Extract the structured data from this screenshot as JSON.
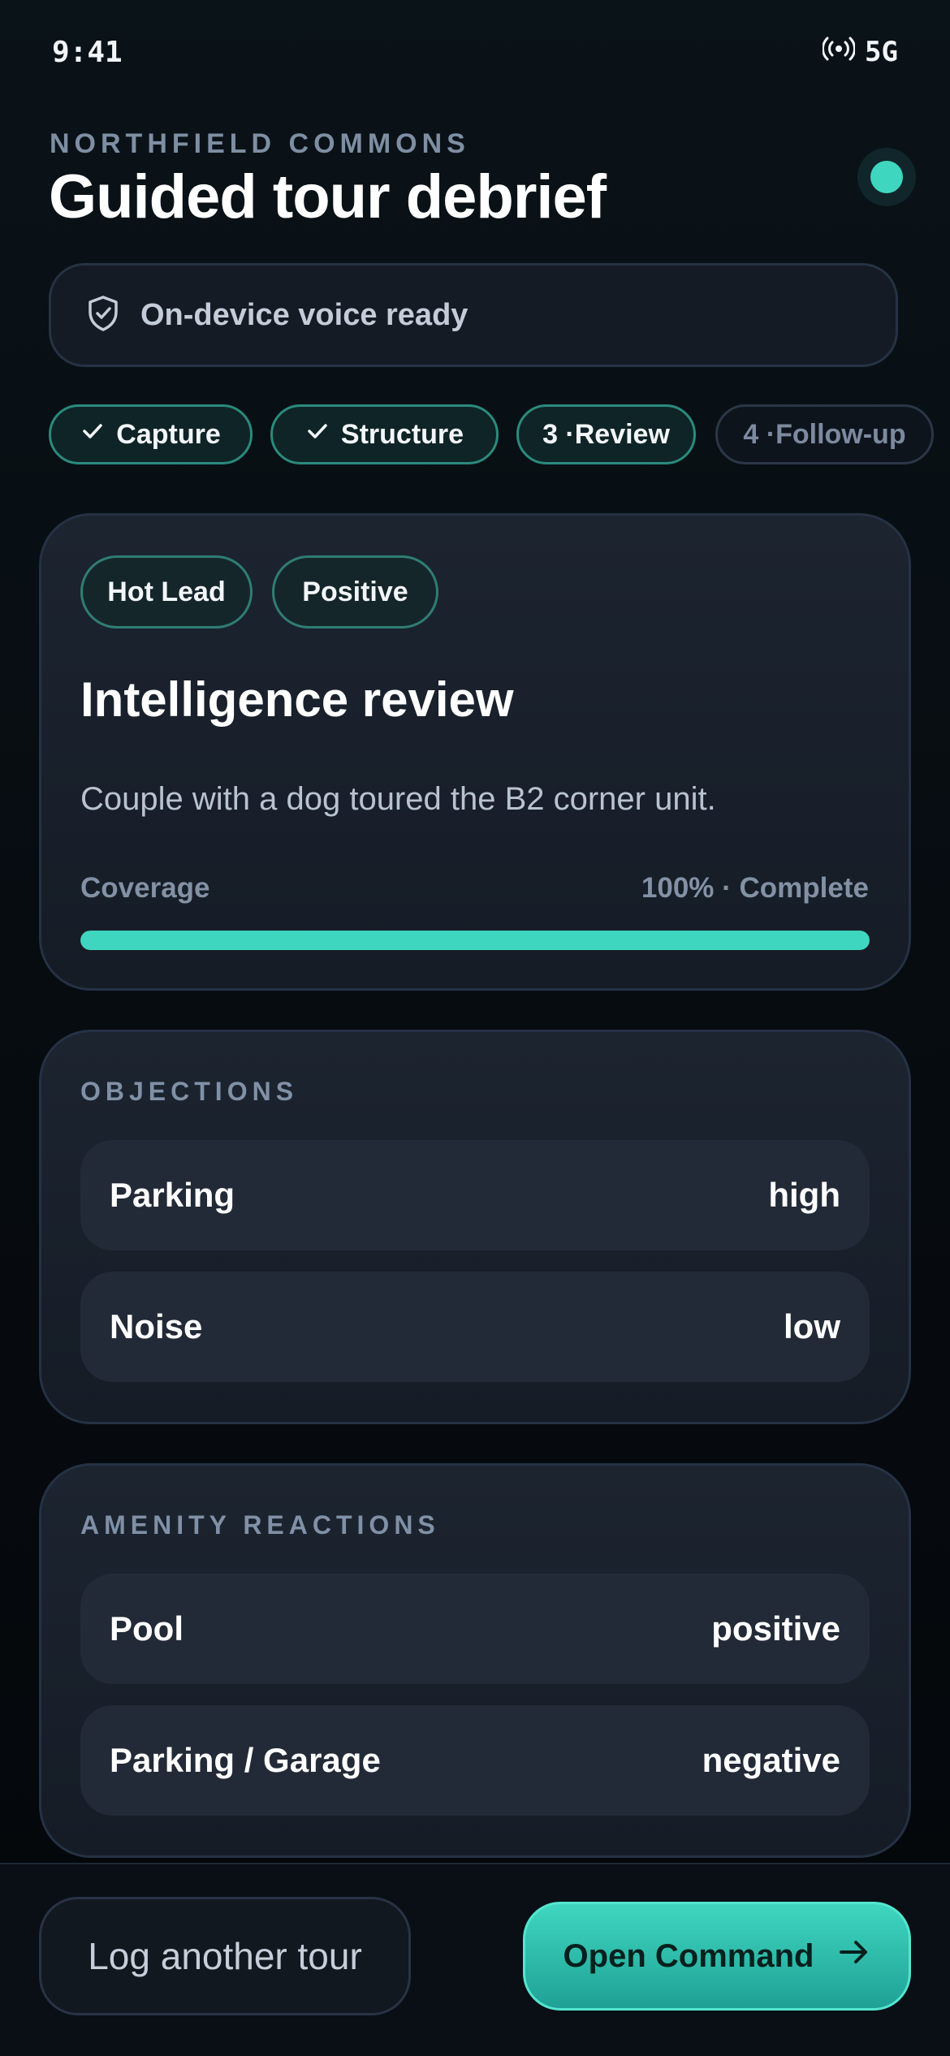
{
  "status_bar": {
    "time": "9:41",
    "network": "5G",
    "signal_icon": "broadcast-icon"
  },
  "header": {
    "eyebrow": "NORTHFIELD COMMONS",
    "title": "Guided tour debrief",
    "live_indicator_color": "#3fd6c0"
  },
  "voice_status": {
    "icon": "shield-check-icon",
    "text": "On-device voice ready"
  },
  "steps": [
    {
      "label": "Capture",
      "state": "done",
      "icon": "check-icon"
    },
    {
      "label": "Structure",
      "state": "done",
      "icon": "check-icon"
    },
    {
      "label": "3 ·Review",
      "state": "active"
    },
    {
      "label": "4 ·Follow-up",
      "state": "todo"
    }
  ],
  "review_card": {
    "tags": [
      "Hot Lead",
      "Positive"
    ],
    "title": "Intelligence review",
    "summary": "Couple with a dog toured the B2 corner unit.",
    "coverage_label": "Coverage",
    "coverage_value": "100% · Complete",
    "coverage_fraction": 1.0
  },
  "objections": {
    "label": "OBJECTIONS",
    "items": [
      {
        "name": "Parking",
        "level": "high"
      },
      {
        "name": "Noise",
        "level": "low"
      }
    ]
  },
  "amenity_reactions": {
    "label": "AMENITY REACTIONS",
    "items": [
      {
        "name": "Pool",
        "reaction": "positive"
      },
      {
        "name": "Parking / Garage",
        "reaction": "negative"
      }
    ]
  },
  "actions": {
    "log_label": "Log another tour",
    "command_label": "Open Command",
    "command_icon": "arrow-right-icon"
  },
  "colors": {
    "accent": "#3fd6c0",
    "background": "#070c11",
    "card": "#1a222d"
  }
}
